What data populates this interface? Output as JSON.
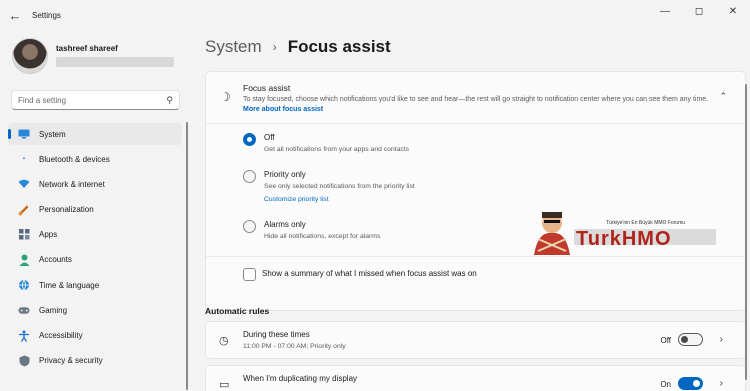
{
  "window": {
    "title": "Settings",
    "back_icon": "back-arrow-icon",
    "controls": [
      "minimize",
      "maximize",
      "close"
    ]
  },
  "profile": {
    "name": "tashreef shareef"
  },
  "search": {
    "placeholder": "Find a setting"
  },
  "sidebar": {
    "items": [
      {
        "label": "System",
        "icon": "system-icon",
        "active": true
      },
      {
        "label": "Bluetooth & devices",
        "icon": "bluetooth-icon"
      },
      {
        "label": "Network & internet",
        "icon": "wifi-icon"
      },
      {
        "label": "Personalization",
        "icon": "brush-icon"
      },
      {
        "label": "Apps",
        "icon": "apps-icon"
      },
      {
        "label": "Accounts",
        "icon": "accounts-icon"
      },
      {
        "label": "Time & language",
        "icon": "globe-icon"
      },
      {
        "label": "Gaming",
        "icon": "gamepad-icon"
      },
      {
        "label": "Accessibility",
        "icon": "accessibility-icon"
      },
      {
        "label": "Privacy & security",
        "icon": "shield-icon"
      }
    ]
  },
  "breadcrumb": {
    "parent": "System",
    "separator": "›",
    "current": "Focus assist"
  },
  "focus_assist": {
    "title": "Focus assist",
    "description": "To stay focused, choose which notifications you'd like to see and hear—the rest will go straight to notification center where you can see them any time.",
    "learn_more": "More about focus assist",
    "options": [
      {
        "label": "Off",
        "sub": "Get all notifications from your apps and contacts",
        "checked": true
      },
      {
        "label": "Priority only",
        "sub": "See only selected notifications from the priority list",
        "link": "Customize priority list",
        "checked": false
      },
      {
        "label": "Alarms only",
        "sub": "Hide all notifications, except for alarms",
        "checked": false
      }
    ],
    "summary_label": "Show a summary of what I missed when focus assist was on",
    "summary_checked": false
  },
  "automatic_rules": {
    "title": "Automatic rules",
    "rules": [
      {
        "title": "During these times",
        "sub": "11:00 PM - 07:00 AM; Priority only",
        "state": "Off",
        "on": false
      },
      {
        "title": "When I'm duplicating my display",
        "sub": "",
        "state": "On",
        "on": true
      }
    ]
  },
  "watermark": {
    "brand": "TurkHMO",
    "tagline": "Türkiye'nin En Büyük MMO Forumu"
  },
  "colors": {
    "accent": "#0067c0",
    "background": "#f3f3f3",
    "card": "#fbfbfb"
  }
}
